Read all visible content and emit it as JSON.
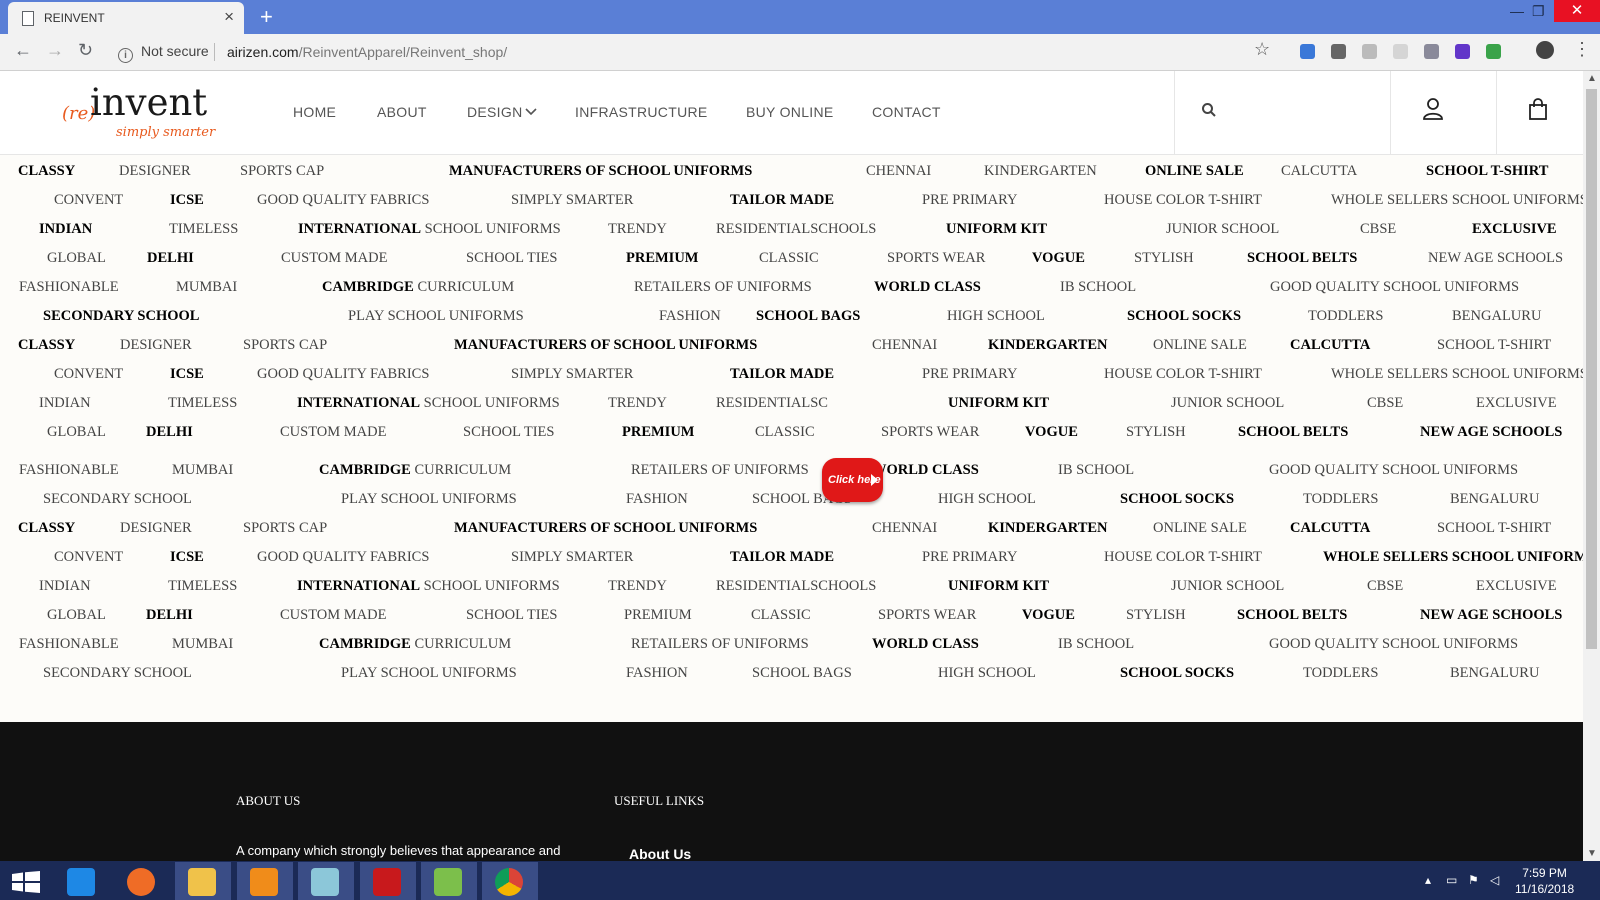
{
  "browser": {
    "tab_title": "REINVENT",
    "security_label": "Not secure",
    "url": "airizen.com/ReinventApparel/Reinvent_shop/",
    "url_domain": "airizen.com",
    "url_path": "/ReinventApparel/Reinvent_shop/"
  },
  "site": {
    "logo_prefix": "(re)",
    "logo_main": "invent",
    "logo_tagline": "simply smarter",
    "nav": [
      "HOME",
      "ABOUT",
      "DESIGN",
      "INFRASTRUCTURE",
      "BUY ONLINE",
      "CONTACT"
    ],
    "click_here_label": "Click here"
  },
  "keyword_rows": [
    [
      {
        "t": "CLASSY",
        "b": true
      },
      {
        "t": "DESIGNER"
      },
      {
        "t": "SPORTS CAP"
      },
      {
        "t": "MANUFACTURERS OF SCHOOL UNIFORMS",
        "b": true
      },
      {
        "t": "CHENNAI"
      },
      {
        "t": "KINDERGARTEN"
      },
      {
        "t": "ONLINE SALE",
        "b": true
      },
      {
        "t": "CALCUTTA"
      },
      {
        "t": "SCHOOL T-SHIRT",
        "b": true
      }
    ],
    [
      {
        "t": "CONVENT"
      },
      {
        "t": "ICSE",
        "b": true
      },
      {
        "t": "GOOD QUALITY FABRICS"
      },
      {
        "t": "SIMPLY SMARTER"
      },
      {
        "t": "TAILOR MADE",
        "b": true
      },
      {
        "t": "PRE PRIMARY"
      },
      {
        "t": "HOUSE COLOR T-SHIRT"
      },
      {
        "t": "WHOLE SELLERS SCHOOL UNIFORMS"
      }
    ],
    [
      {
        "t": "INDIAN",
        "b": true
      },
      {
        "t": "TIMELESS"
      },
      {
        "t": "INTERNATIONAL",
        "b": true,
        "rest": " SCHOOL UNIFORMS"
      },
      {
        "t": "TRENDY"
      },
      {
        "t": "RESIDENTIALSCHOOLS"
      },
      {
        "t": "UNIFORM KIT",
        "b": true
      },
      {
        "t": "JUNIOR SCHOOL"
      },
      {
        "t": "CBSE"
      },
      {
        "t": "EXCLUSIVE",
        "b": true
      }
    ],
    [
      {
        "t": "GLOBAL"
      },
      {
        "t": "DELHI",
        "b": true
      },
      {
        "t": "CUSTOM MADE"
      },
      {
        "t": "SCHOOL TIES"
      },
      {
        "t": "PREMIUM",
        "b": true
      },
      {
        "t": "CLASSIC"
      },
      {
        "t": "SPORTS WEAR"
      },
      {
        "t": "VOGUE",
        "b": true
      },
      {
        "t": "STYLISH"
      },
      {
        "t": "SCHOOL BELTS",
        "b": true
      },
      {
        "t": "NEW AGE SCHOOLS"
      }
    ],
    [
      {
        "t": "FASHIONABLE"
      },
      {
        "t": "MUMBAI"
      },
      {
        "t": "CAMBRIDGE",
        "b": true,
        "rest": " CURRICULUM"
      },
      {
        "t": "RETAILERS OF UNIFORMS"
      },
      {
        "t": "WORLD CLASS",
        "b": true
      },
      {
        "t": "IB SCHOOL"
      },
      {
        "t": "GOOD QUALITY SCHOOL UNIFORMS"
      }
    ],
    [
      {
        "t": "SECONDARY SCHOOL",
        "b": true
      },
      {
        "t": "PLAY SCHOOL UNIFORMS"
      },
      {
        "t": "FASHION"
      },
      {
        "t": "SCHOOL BAGS",
        "b": true
      },
      {
        "t": "HIGH SCHOOL"
      },
      {
        "t": "SCHOOL SOCKS",
        "b": true
      },
      {
        "t": "TODDLERS"
      },
      {
        "t": "BENGALURU"
      }
    ],
    [
      {
        "t": "CLASSY",
        "b": true
      },
      {
        "t": "DESIGNER"
      },
      {
        "t": "SPORTS CAP"
      },
      {
        "t": "MANUFACTURERS OF SCHOOL UNIFORMS",
        "b": true
      },
      {
        "t": "CHENNAI"
      },
      {
        "t": "KINDERGARTEN",
        "b": true
      },
      {
        "t": "ONLINE SALE"
      },
      {
        "t": "CALCUTTA",
        "b": true
      },
      {
        "t": "SCHOOL T-SHIRT"
      }
    ],
    [
      {
        "t": "CONVENT"
      },
      {
        "t": "ICSE",
        "b": true
      },
      {
        "t": "GOOD QUALITY FABRICS"
      },
      {
        "t": "SIMPLY SMARTER"
      },
      {
        "t": "TAILOR MADE",
        "b": true
      },
      {
        "t": "PRE PRIMARY"
      },
      {
        "t": "HOUSE COLOR T-SHIRT"
      },
      {
        "t": "WHOLE SELLERS SCHOOL UNIFORMS"
      }
    ],
    [
      {
        "t": "INDIAN"
      },
      {
        "t": "TIMELESS"
      },
      {
        "t": "INTERNATIONAL",
        "b": true,
        "rest": " SCHOOL UNIFORMS"
      },
      {
        "t": "TRENDY"
      },
      {
        "t": "RESIDENTIALSC"
      },
      {
        "t": "UNIFORM KIT",
        "b": true
      },
      {
        "t": "JUNIOR SCHOOL"
      },
      {
        "t": "CBSE"
      },
      {
        "t": "EXCLUSIVE"
      }
    ],
    [
      {
        "t": "GLOBAL"
      },
      {
        "t": "DELHI",
        "b": true
      },
      {
        "t": "CUSTOM MADE"
      },
      {
        "t": "SCHOOL TIES"
      },
      {
        "t": "PREMIUM",
        "b": true
      },
      {
        "t": "CLASSIC"
      },
      {
        "t": "SPORTS WEAR"
      },
      {
        "t": "VOGUE",
        "b": true
      },
      {
        "t": "STYLISH"
      },
      {
        "t": "SCHOOL BELTS",
        "b": true
      },
      {
        "t": "NEW AGE SCHOOLS",
        "b": true
      }
    ],
    [
      {
        "t": "FASHIONABLE"
      },
      {
        "t": "MUMBAI"
      },
      {
        "t": "CAMBRIDGE",
        "b": true,
        "rest": " CURRICULUM"
      },
      {
        "t": "RETAILERS OF UNIFORMS"
      },
      {
        "t": "WORLD CLASS",
        "b": true
      },
      {
        "t": "IB SCHOOL"
      },
      {
        "t": "GOOD QUALITY SCHOOL UNIFORMS"
      }
    ],
    [
      {
        "t": "SECONDARY SCHOOL"
      },
      {
        "t": "PLAY SCHOOL UNIFORMS"
      },
      {
        "t": "FASHION"
      },
      {
        "t": "SCHOOL BAGS"
      },
      {
        "t": "HIGH SCHOOL"
      },
      {
        "t": "SCHOOL SOCKS",
        "b": true
      },
      {
        "t": "TODDLERS"
      },
      {
        "t": "BENGALURU"
      }
    ],
    [
      {
        "t": "CLASSY",
        "b": true
      },
      {
        "t": "DESIGNER"
      },
      {
        "t": "SPORTS CAP"
      },
      {
        "t": "MANUFACTURERS OF SCHOOL UNIFORMS",
        "b": true
      },
      {
        "t": "CHENNAI"
      },
      {
        "t": "KINDERGARTEN",
        "b": true
      },
      {
        "t": "ONLINE SALE"
      },
      {
        "t": "CALCUTTA",
        "b": true
      },
      {
        "t": "SCHOOL T-SHIRT"
      }
    ],
    [
      {
        "t": "CONVENT"
      },
      {
        "t": "ICSE",
        "b": true
      },
      {
        "t": "GOOD QUALITY FABRICS"
      },
      {
        "t": "SIMPLY SMARTER"
      },
      {
        "t": "TAILOR MADE",
        "b": true
      },
      {
        "t": "PRE PRIMARY"
      },
      {
        "t": "HOUSE COLOR T-SHIRT"
      },
      {
        "t": "WHOLE SELLERS SCHOOL UNIFORMS",
        "b": true
      }
    ],
    [
      {
        "t": "INDIAN"
      },
      {
        "t": "TIMELESS"
      },
      {
        "t": "INTERNATIONAL",
        "b": true,
        "rest": " SCHOOL UNIFORMS"
      },
      {
        "t": "TRENDY"
      },
      {
        "t": "RESIDENTIALSCHOOLS"
      },
      {
        "t": "UNIFORM KIT",
        "b": true
      },
      {
        "t": "JUNIOR SCHOOL"
      },
      {
        "t": "CBSE"
      },
      {
        "t": "EXCLUSIVE"
      }
    ],
    [
      {
        "t": "GLOBAL"
      },
      {
        "t": "DELHI",
        "b": true
      },
      {
        "t": "CUSTOM MADE"
      },
      {
        "t": "SCHOOL TIES"
      },
      {
        "t": "PREMIUM"
      },
      {
        "t": "CLASSIC"
      },
      {
        "t": "SPORTS WEAR"
      },
      {
        "t": "VOGUE",
        "b": true
      },
      {
        "t": "STYLISH"
      },
      {
        "t": "SCHOOL BELTS",
        "b": true
      },
      {
        "t": "NEW AGE SCHOOLS",
        "b": true
      }
    ],
    [
      {
        "t": "FASHIONABLE"
      },
      {
        "t": "MUMBAI"
      },
      {
        "t": "CAMBRIDGE",
        "b": true,
        "rest": " CURRICULUM"
      },
      {
        "t": "RETAILERS OF UNIFORMS"
      },
      {
        "t": "WORLD CLASS",
        "b": true
      },
      {
        "t": "IB SCHOOL"
      },
      {
        "t": "GOOD QUALITY SCHOOL UNIFORMS"
      }
    ],
    [
      {
        "t": "SECONDARY SCHOOL"
      },
      {
        "t": "PLAY SCHOOL UNIFORMS"
      },
      {
        "t": "FASHION"
      },
      {
        "t": "SCHOOL BAGS"
      },
      {
        "t": "HIGH SCHOOL"
      },
      {
        "t": "SCHOOL SOCKS",
        "b": true
      },
      {
        "t": "TODDLERS"
      },
      {
        "t": "BENGALURU"
      }
    ]
  ],
  "footer": {
    "about_heading": "ABOUT US",
    "useful_heading": "USEFUL LINKS",
    "about_text": "A company which strongly believes that appearance and",
    "about_link": "About Us"
  },
  "taskbar": {
    "time": "7:59 PM",
    "date": "11/16/2018",
    "apps": [
      "internet-explorer",
      "firefox",
      "file-explorer",
      "sublime-text",
      "file-manager",
      "filezilla",
      "notepad",
      "chrome"
    ]
  },
  "colors": {
    "tabbar": "#5a7fd6",
    "logo_accent": "#e85a1e",
    "cta_red": "#e01818",
    "footer_bg": "#111111",
    "taskbar": "#1b2a56"
  }
}
